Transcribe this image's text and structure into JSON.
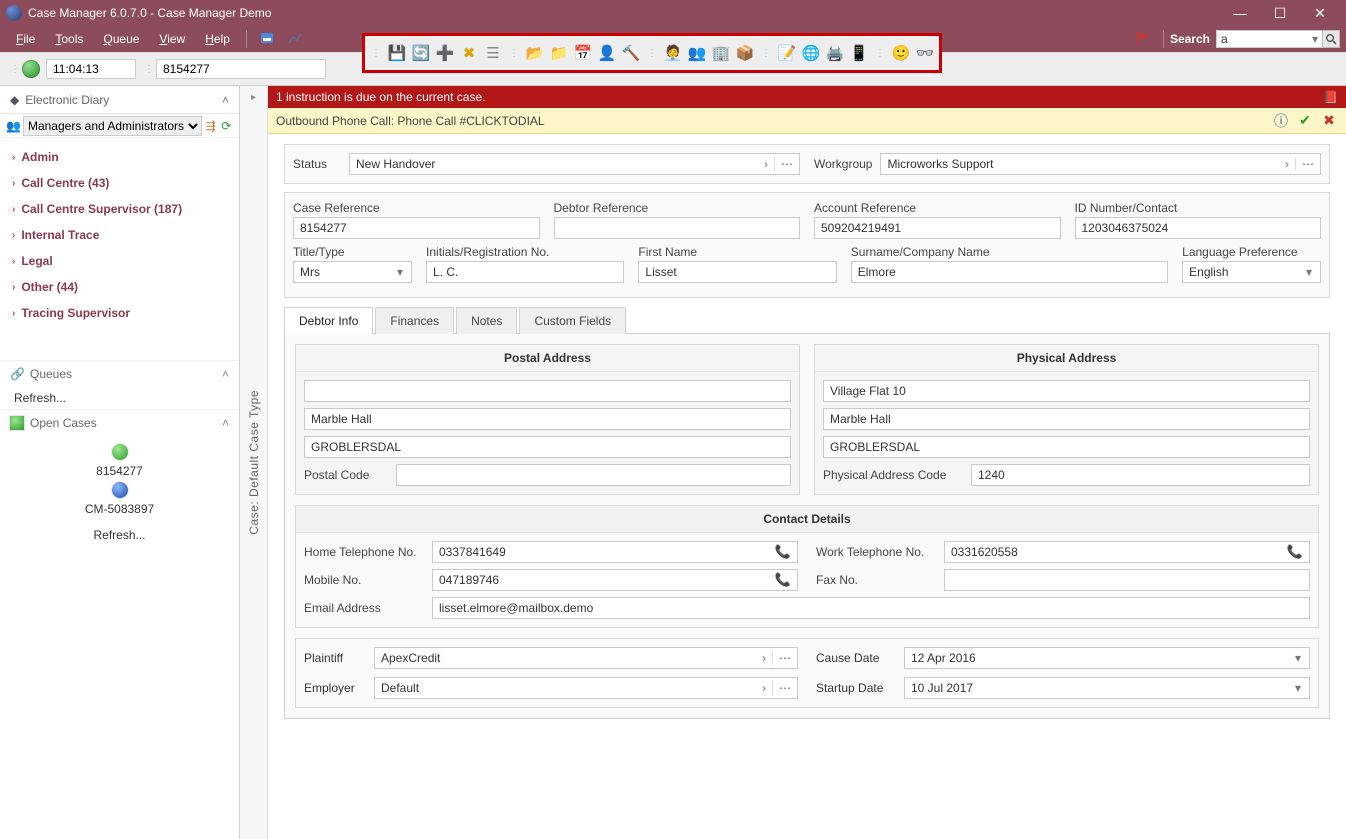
{
  "window": {
    "title": "Case Manager 6.0.7.0 - Case Manager Demo"
  },
  "menu": {
    "file": "File",
    "tools": "Tools",
    "queue": "Queue",
    "view": "View",
    "help": "Help",
    "search_label": "Search",
    "search_value": "a"
  },
  "toolstrip": {
    "time": "11:04:13",
    "case_no": "8154277"
  },
  "alert": {
    "text": "1 instruction is due on the current case."
  },
  "call_bar": {
    "text": "Outbound Phone Call: Phone Call #CLICKTODIAL"
  },
  "vstrip": {
    "label": "Case: Default Case Type"
  },
  "sidebar": {
    "diary_header": "Electronic Diary",
    "role_select": "Managers and Administrators",
    "tree": [
      {
        "label": "Admin"
      },
      {
        "label": "Call Centre (43)"
      },
      {
        "label": "Call Centre Supervisor (187)"
      },
      {
        "label": "Internal Trace"
      },
      {
        "label": "Legal"
      },
      {
        "label": "Other (44)"
      },
      {
        "label": "Tracing Supervisor"
      }
    ],
    "queues_header": "Queues",
    "queues_refresh": "Refresh...",
    "open_cases_header": "Open Cases",
    "open_cases": [
      {
        "label": "8154277",
        "color": "green"
      },
      {
        "label": "CM-5083897",
        "color": "blue"
      }
    ],
    "open_refresh": "Refresh..."
  },
  "form": {
    "status_label": "Status",
    "status_value": "New Handover",
    "workgroup_label": "Workgroup",
    "workgroup_value": "Microworks Support",
    "case_ref_label": "Case Reference",
    "case_ref": "8154277",
    "debtor_ref_label": "Debtor Reference",
    "debtor_ref": "",
    "account_ref_label": "Account Reference",
    "account_ref": "509204219491",
    "idnum_label": "ID Number/Contact",
    "idnum": "1203046375024",
    "title_label": "Title/Type",
    "title": "Mrs",
    "initials_label": "Initials/Registration No.",
    "initials": "L. C.",
    "first_label": "First Name",
    "first": "Lisset",
    "surname_label": "Surname/Company Name",
    "surname": "Elmore",
    "lang_label": "Language Preference",
    "lang": "English"
  },
  "tabs": {
    "debtor": "Debtor Info",
    "finances": "Finances",
    "notes": "Notes",
    "custom": "Custom Fields"
  },
  "address": {
    "postal_header": "Postal Address",
    "postal": {
      "l1": "",
      "l2": "Marble Hall",
      "l3": "GROBLERSDAL",
      "code_label": "Postal Code",
      "code": ""
    },
    "physical_header": "Physical Address",
    "physical": {
      "l1": "Village Flat 10",
      "l2": "Marble Hall",
      "l3": "GROBLERSDAL",
      "code_label": "Physical Address Code",
      "code": "1240"
    }
  },
  "contact": {
    "header": "Contact Details",
    "home_label": "Home Telephone No.",
    "home": "0337841649",
    "work_label": "Work Telephone No.",
    "work": "0331620558",
    "mobile_label": "Mobile No.",
    "mobile": "047189746",
    "fax_label": "Fax No.",
    "fax": "",
    "email_label": "Email Address",
    "email": "lisset.elmore@mailbox.demo"
  },
  "extra": {
    "plaintiff_label": "Plaintiff",
    "plaintiff": "ApexCredit",
    "cause_label": "Cause Date",
    "cause": "12 Apr 2016",
    "employer_label": "Employer",
    "employer": "Default",
    "startup_label": "Startup Date",
    "startup": "10 Jul 2017"
  }
}
